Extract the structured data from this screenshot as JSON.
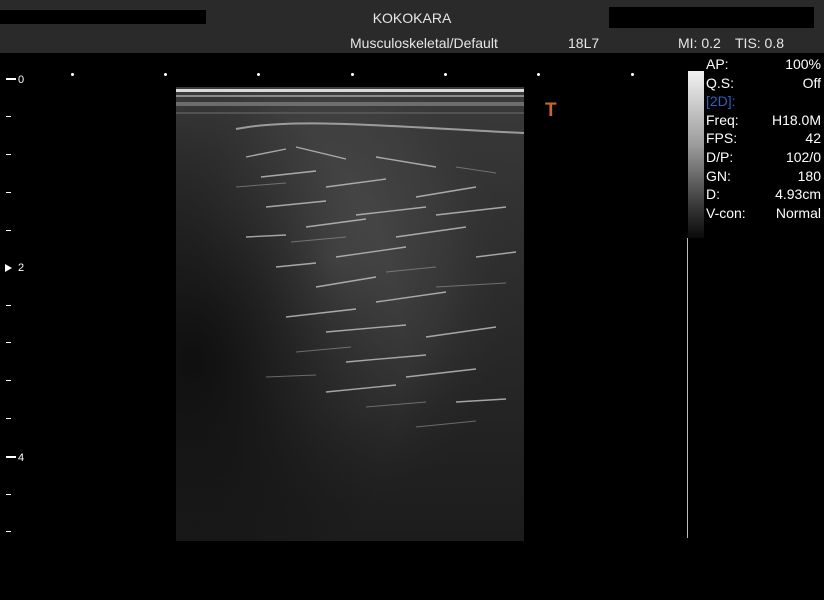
{
  "header": {
    "title": "KOKOKARA",
    "preset": "Musculoskeletal/Default",
    "probe": "18L7",
    "mi": "MI:  0.2",
    "tis": "TIS:  0.8"
  },
  "depth_scale": {
    "labels": [
      "0",
      "2",
      "4"
    ]
  },
  "orientation_marker": "T",
  "params": {
    "ap": {
      "key": "AP:",
      "value": "100%"
    },
    "qs": {
      "key": "Q.S:",
      "value": "Off"
    },
    "mode": {
      "key": "[2D]:",
      "value": ""
    },
    "freq": {
      "key": "Freq:",
      "value": "H18.0M"
    },
    "fps": {
      "key": "FPS:",
      "value": "42"
    },
    "dp": {
      "key": "D/P:",
      "value": "102/0"
    },
    "gn": {
      "key": "GN:",
      "value": "180"
    },
    "d": {
      "key": "D:",
      "value": "4.93cm"
    },
    "vcon": {
      "key": "V-con:",
      "value": "Normal"
    }
  },
  "colors": {
    "mode_label": "#2f5fbf",
    "orientation": "#c8682e",
    "header_bg": "#2a2a2a"
  }
}
